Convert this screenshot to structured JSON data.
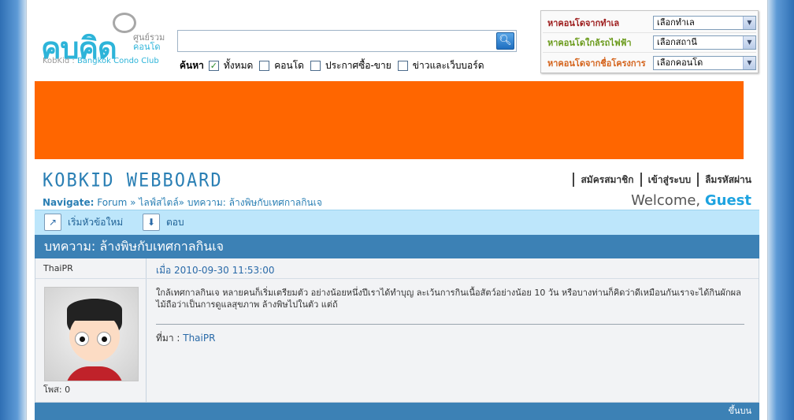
{
  "logo": {
    "main": "คบคิด",
    "side_line1": "ศูนย์รวม",
    "side_line2": "คอนโด",
    "tag_prefix": "KobKid : ",
    "tag_brand": "Bangkok Condo Club"
  },
  "search": {
    "value": "",
    "label": "ค้นหา",
    "options": [
      {
        "label": "ทั้งหมด",
        "checked": true
      },
      {
        "label": "คอนโด",
        "checked": false
      },
      {
        "label": "ประกาศซื้อ-ขาย",
        "checked": false
      },
      {
        "label": "ข่าวและเว็บบอร์ด",
        "checked": false
      }
    ]
  },
  "finder": [
    {
      "label": "หาคอนโดจากทำเล",
      "select": "เลือกทำเล"
    },
    {
      "label": "หาคอนโดใกล้รถไฟฟ้า",
      "select": "เลือกสถานี"
    },
    {
      "label": "หาคอนโดจากชื่อโครงการ",
      "select": "เลือกคอนโด"
    }
  ],
  "board": {
    "title": "KOBKID WEBBOARD",
    "nav_label": "Navigate:",
    "nav_path": "Forum » ไลฟ์สไตล์» บทความ: ล้างพิษกับเทศกาลกินเจ",
    "user_links": [
      "สมัครสมาชิก",
      "เข้าสู่ระบบ",
      "ลืมรหัสผ่าน"
    ],
    "welcome_prefix": "Welcome, ",
    "welcome_user": "Guest"
  },
  "toolbar": {
    "new_topic": "เริ่มหัวข้อใหม่",
    "reply": "ตอบ"
  },
  "post": {
    "title": "บทความ: ล้างพิษกับเทศกาลกินเจ",
    "author": "ThaiPR",
    "author_posts": "โพส: 0",
    "date": "เมื่อ 2010-09-30 11:53:00",
    "body": "ใกล้เทศกาลกินเจ หลายคนก็เริ่มเตรียมตัว อย่างน้อยหนึ่งปีเราได้ทำบุญ ละเว้นการกินเนื้อสัตว์อย่างน้อย 10 วัน หรือบางท่านก็คิดว่าดีเหมือนกันเราจะได้กินผักผลไม้ถือว่าเป็นการดูแลสุขภาพ ล้างพิษไปในตัว แต่ถ้",
    "source_label": "ที่มา : ",
    "source_link": "ThaiPR",
    "back_to_top": "ขึ้นบน"
  },
  "colors": {
    "accent": "#3c81b5",
    "brand": "#2db4d9",
    "banner": "#ff6600",
    "toolbar": "#bde6fb"
  }
}
